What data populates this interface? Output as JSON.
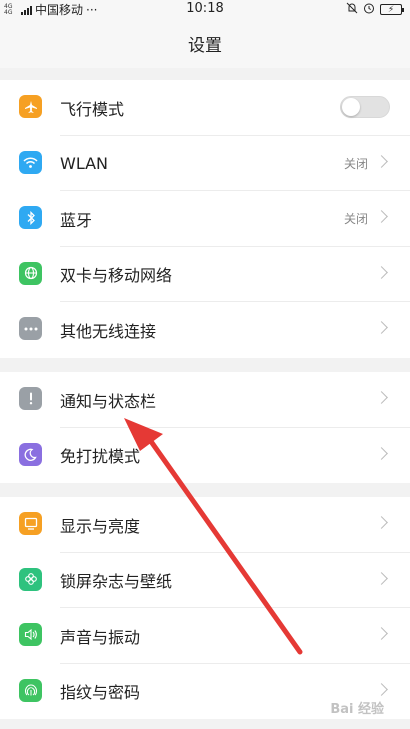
{
  "status": {
    "network": "4G 4G",
    "carrier": "中国移动",
    "dots": "···",
    "time": "10:18",
    "battery_icon": "charging-battery-icon"
  },
  "header": {
    "title": "设置"
  },
  "groups": [
    {
      "items": [
        {
          "label": "飞行模式",
          "icon": "airplane-icon",
          "color": "#f6a023",
          "control": "toggle",
          "toggle_on": false
        },
        {
          "label": "WLAN",
          "icon": "wifi-icon",
          "color": "#2fa9f2",
          "value": "关闭"
        },
        {
          "label": "蓝牙",
          "icon": "bluetooth-icon",
          "color": "#2fa9f2",
          "value": "关闭"
        },
        {
          "label": "双卡与移动网络",
          "icon": "globe-icon",
          "color": "#3ec462"
        },
        {
          "label": "其他无线连接",
          "icon": "more-icon",
          "color": "#9aa0a6"
        }
      ]
    },
    {
      "items": [
        {
          "label": "通知与状态栏",
          "icon": "exclamation-icon",
          "color": "#9aa0a6"
        },
        {
          "label": "免打扰模式",
          "icon": "moon-icon",
          "color": "#8a6fe0"
        }
      ]
    },
    {
      "items": [
        {
          "label": "显示与亮度",
          "icon": "display-icon",
          "color": "#f6a023"
        },
        {
          "label": "锁屏杂志与壁纸",
          "icon": "flower-icon",
          "color": "#2ec27e"
        },
        {
          "label": "声音与振动",
          "icon": "speaker-icon",
          "color": "#3ec462"
        },
        {
          "label": "指纹与密码",
          "icon": "fingerprint-icon",
          "color": "#3ec462"
        }
      ]
    }
  ],
  "annotation": {
    "icon": "red-arrow-annotation",
    "color": "#e53935"
  },
  "watermark": "Bai 经验"
}
